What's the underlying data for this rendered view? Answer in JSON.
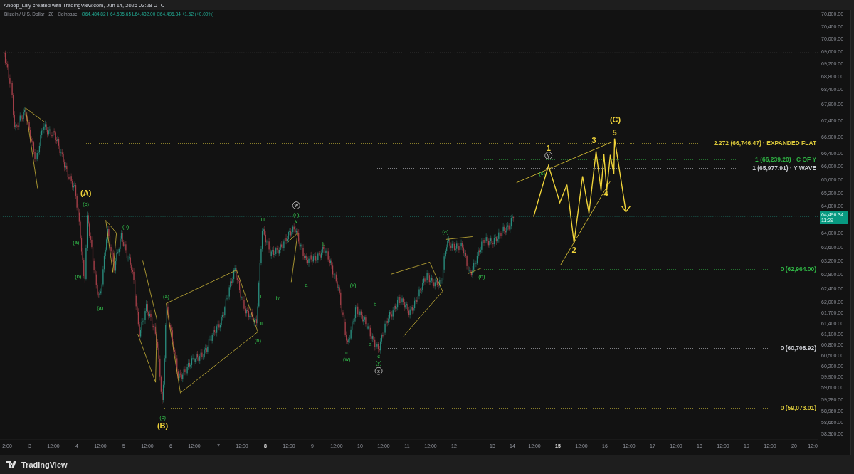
{
  "top_bar": {
    "title": "Anoop_Lilly created with TradingView.com, Jun 14, 2026 03:28 UTC"
  },
  "legend": {
    "symbol": "Bitcoin / U.S. Dollar · 20 · Coinbase",
    "ohlc": "O64,484.82 H64,505.65 L64,482.00 C64,496.34 +1.52 (+0.00%)"
  },
  "price_axis": [
    "70,800.00",
    "70,400.00",
    "70,000.00",
    "69,600.00",
    "69,200.00",
    "68,800.00",
    "68,400.00",
    "67,900.00",
    "67,400.00",
    "66,900.00",
    "66,400.00",
    "66,000.00",
    "65,600.00",
    "65,200.00",
    "64,800.00",
    "64,000.00",
    "63,600.00",
    "63,200.00",
    "62,800.00",
    "62,400.00",
    "62,000.00",
    "61,700.00",
    "61,400.00",
    "61,100.00",
    "60,800.00",
    "60,500.00",
    "60,200.00",
    "59,900.00",
    "59,600.00",
    "59,280.00",
    "58,960.00",
    "58,660.00",
    "58,360.00"
  ],
  "price_badge": {
    "price": "64,496.34",
    "countdown": "11:29"
  },
  "fib_levels": [
    {
      "label": "2.272 (66,746.47) · EXPANDED FLAT",
      "color": "#d8c63a"
    },
    {
      "label": "1 (66,239.20) · C OF Y",
      "color": "#2fb344"
    },
    {
      "label": "1 (65,977.91) · Y WAVE",
      "color": "#c8cad0"
    },
    {
      "label": "0 (62,964.00)",
      "color": "#2fb344"
    },
    {
      "label": "0 (60,708.92)",
      "color": "#c8cad0"
    },
    {
      "label": "0 (59,073.01)",
      "color": "#d8c63a"
    }
  ],
  "wave_labels": [
    {
      "text": "(A)",
      "kind": "major"
    },
    {
      "text": "(B)",
      "kind": "major"
    },
    {
      "text": "(C)",
      "kind": "major"
    },
    {
      "text": "1",
      "kind": "major"
    },
    {
      "text": "2",
      "kind": "major"
    },
    {
      "text": "3",
      "kind": "major"
    },
    {
      "text": "4",
      "kind": "major"
    },
    {
      "text": "5",
      "kind": "major"
    },
    {
      "text": "(c)",
      "kind": "minor"
    },
    {
      "text": "(a)",
      "kind": "minor"
    },
    {
      "text": "(b)",
      "kind": "minor"
    },
    {
      "text": "(b)",
      "kind": "minor"
    },
    {
      "text": "(a)",
      "kind": "minor"
    },
    {
      "text": "(a)",
      "kind": "minor"
    },
    {
      "text": "(c)",
      "kind": "minor"
    },
    {
      "text": "(b)",
      "kind": "minor"
    },
    {
      "text": "iii",
      "kind": "minor"
    },
    {
      "text": "i",
      "kind": "minor"
    },
    {
      "text": "ii",
      "kind": "minor"
    },
    {
      "text": "iv",
      "kind": "minor"
    },
    {
      "text": "(c)",
      "kind": "minor"
    },
    {
      "text": "v",
      "kind": "minor"
    },
    {
      "text": "a",
      "kind": "minor"
    },
    {
      "text": "b",
      "kind": "minor"
    },
    {
      "text": "(x)",
      "kind": "minor"
    },
    {
      "text": "c",
      "kind": "minor"
    },
    {
      "text": "(w)",
      "kind": "minor"
    },
    {
      "text": "b",
      "kind": "minor"
    },
    {
      "text": "a",
      "kind": "minor"
    },
    {
      "text": "c",
      "kind": "minor"
    },
    {
      "text": "(y)",
      "kind": "minor"
    },
    {
      "text": "(a)",
      "kind": "minor"
    },
    {
      "text": "(b)",
      "kind": "minor"
    },
    {
      "text": "(c)",
      "kind": "minor"
    },
    {
      "text": "w",
      "kind": "circled"
    },
    {
      "text": "x",
      "kind": "circled"
    },
    {
      "text": "y",
      "kind": "circled"
    }
  ],
  "time_axis": [
    {
      "text": "2:00",
      "bold": false
    },
    {
      "text": "3",
      "bold": false
    },
    {
      "text": "12:00",
      "bold": false
    },
    {
      "text": "4",
      "bold": false
    },
    {
      "text": "12:00",
      "bold": false
    },
    {
      "text": "5",
      "bold": false
    },
    {
      "text": "12:00",
      "bold": false
    },
    {
      "text": "6",
      "bold": false
    },
    {
      "text": "12:00",
      "bold": false
    },
    {
      "text": "7",
      "bold": false
    },
    {
      "text": "12:00",
      "bold": false
    },
    {
      "text": "8",
      "bold": true
    },
    {
      "text": "12:00",
      "bold": false
    },
    {
      "text": "9",
      "bold": false
    },
    {
      "text": "12:00",
      "bold": false
    },
    {
      "text": "10",
      "bold": false
    },
    {
      "text": "12:00",
      "bold": false
    },
    {
      "text": "11",
      "bold": false
    },
    {
      "text": "12:00",
      "bold": false
    },
    {
      "text": "12",
      "bold": false
    },
    {
      "text": "13",
      "bold": false
    },
    {
      "text": "14",
      "bold": false
    },
    {
      "text": "12:00",
      "bold": false
    },
    {
      "text": "15",
      "bold": true
    },
    {
      "text": "12:00",
      "bold": false
    },
    {
      "text": "16",
      "bold": false
    },
    {
      "text": "12:00",
      "bold": false
    },
    {
      "text": "17",
      "bold": false
    },
    {
      "text": "12:00",
      "bold": false
    },
    {
      "text": "18",
      "bold": false
    },
    {
      "text": "12:00",
      "bold": false
    },
    {
      "text": "19",
      "bold": false
    },
    {
      "text": "12:00",
      "bold": false
    },
    {
      "text": "20",
      "bold": false
    },
    {
      "text": "12:0",
      "bold": false
    }
  ],
  "footer": {
    "brand": "TradingView"
  }
}
